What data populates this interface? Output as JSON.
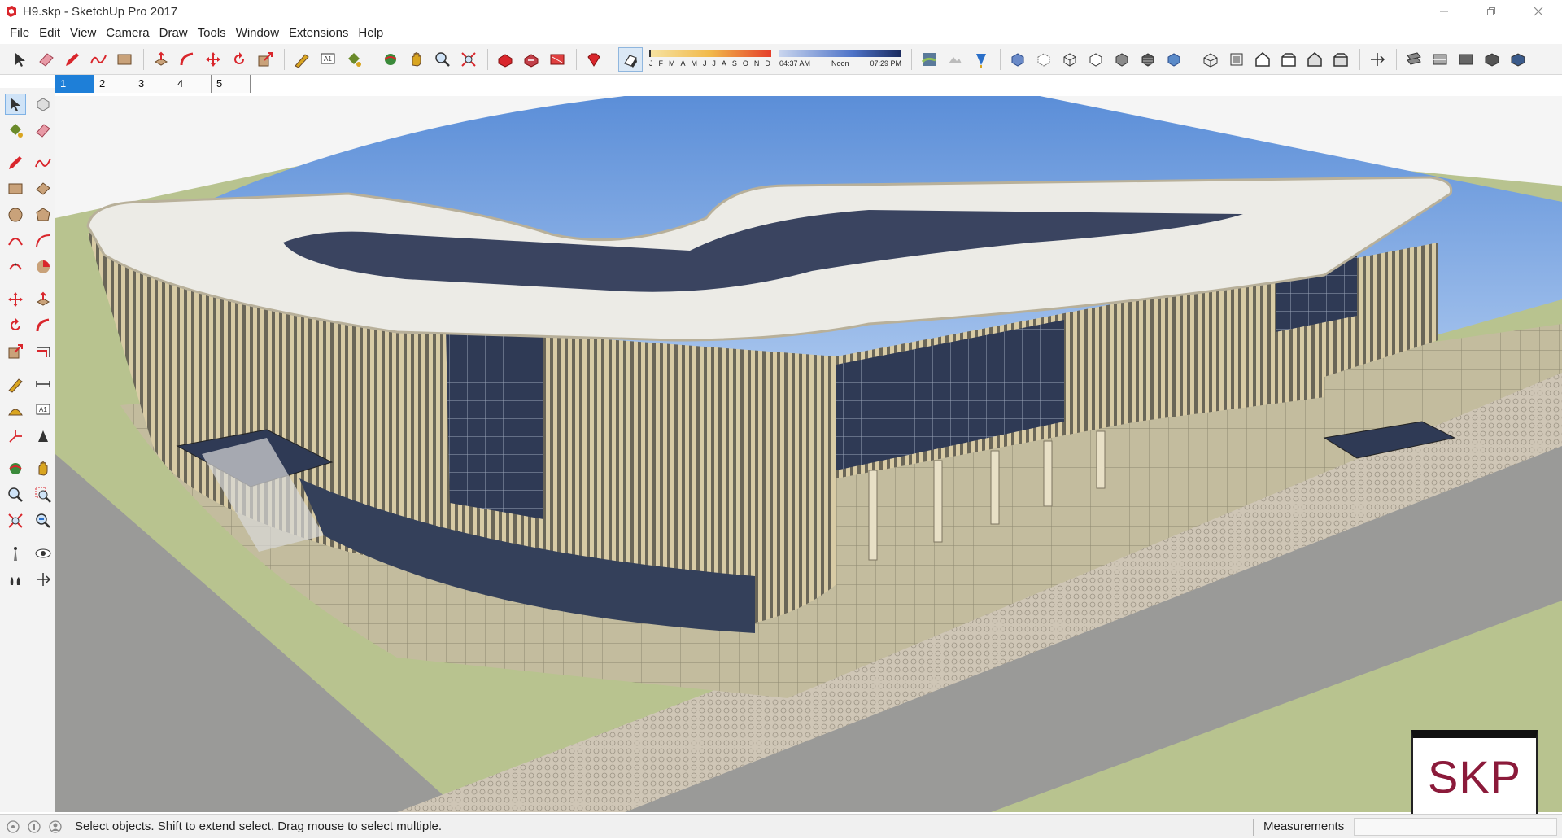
{
  "window": {
    "title": "H9.skp - SketchUp Pro 2017",
    "controls": [
      "minimize",
      "maximize",
      "close"
    ]
  },
  "menubar": {
    "items": [
      "File",
      "Edit",
      "View",
      "Camera",
      "Draw",
      "Tools",
      "Window",
      "Extensions",
      "Help"
    ]
  },
  "toolbar": {
    "groups": [
      [
        "select-icon",
        "eraser-icon",
        "pencil-icon",
        "freehand-icon",
        "rectangle-icon"
      ],
      [
        "push-pull-icon",
        "follow-me-icon",
        "move-icon",
        "rotate-icon",
        "scale-icon"
      ],
      [
        "tape-measure-icon",
        "text-icon",
        "paint-bucket-icon"
      ],
      [
        "orbit-icon",
        "pan-icon",
        "zoom-icon",
        "zoom-extents-icon"
      ],
      [
        "3d-warehouse-icon",
        "extension-warehouse-icon",
        "layout-icon"
      ],
      [
        "ruby-icon"
      ]
    ],
    "shadows": {
      "toggle_icon": "shadows-toggle-icon",
      "months": [
        "J",
        "F",
        "M",
        "A",
        "M",
        "J",
        "J",
        "A",
        "S",
        "O",
        "N",
        "D"
      ],
      "time_start": "04:37 AM",
      "time_mid": "Noon",
      "time_end": "07:29 PM"
    },
    "groups_after": [
      [
        "add-location-icon",
        "toggle-terrain-icon",
        "photo-textures-icon"
      ],
      [
        "xray-icon",
        "back-edges-icon",
        "wireframe-icon",
        "hidden-line-icon",
        "shaded-icon",
        "shaded-textures-icon",
        "monochrome-icon"
      ],
      [
        "iso-view-icon",
        "top-view-icon",
        "front-view-icon",
        "right-view-icon",
        "back-view-icon",
        "left-view-icon"
      ],
      [
        "section-plane-icon"
      ],
      [
        "display-section-planes-icon",
        "display-section-cuts-icon",
        "display-section-fill-icon",
        "components-icon",
        "styles-icon"
      ]
    ]
  },
  "scenes": {
    "tabs": [
      "1",
      "2",
      "3",
      "4",
      "5"
    ],
    "active": "1"
  },
  "lefttools": {
    "rows": [
      [
        "select-icon",
        "make-component-icon"
      ],
      [
        "paint-bucket-icon",
        "eraser-icon"
      ],
      [
        "gap"
      ],
      [
        "line-icon",
        "freehand-icon"
      ],
      [
        "rectangle-icon",
        "rotated-rectangle-icon"
      ],
      [
        "circle-icon",
        "polygon-icon"
      ],
      [
        "arc-icon",
        "two-point-arc-icon"
      ],
      [
        "three-point-arc-icon",
        "pie-icon"
      ],
      [
        "gap"
      ],
      [
        "move-icon",
        "push-pull-icon"
      ],
      [
        "rotate-icon",
        "follow-me-icon"
      ],
      [
        "scale-icon",
        "offset-icon"
      ],
      [
        "gap"
      ],
      [
        "tape-measure-icon",
        "dimensions-icon"
      ],
      [
        "protractor-icon",
        "text-icon"
      ],
      [
        "axes-icon",
        "3d-text-icon"
      ],
      [
        "gap"
      ],
      [
        "orbit-icon",
        "pan-icon"
      ],
      [
        "zoom-icon",
        "zoom-window-icon"
      ],
      [
        "zoom-extents-icon",
        "previous-view-icon"
      ],
      [
        "gap"
      ],
      [
        "position-camera-icon",
        "look-around-icon"
      ],
      [
        "walk-icon",
        "section-plane-icon"
      ]
    ]
  },
  "badge": {
    "text": "SKP"
  },
  "statusbar": {
    "icons": [
      "geo-location-icon",
      "credits-icon",
      "user-icon"
    ],
    "message": "Select objects. Shift to extend select. Drag mouse to select multiple.",
    "measurements_label": "Measurements",
    "measurements_value": ""
  },
  "colors": {
    "sky": "#7aa7e0",
    "ground": "#b8c38f",
    "road": "#9a9a98",
    "facade": "#cdbd96",
    "glass": "#3a4560",
    "roof": "#ecebe6",
    "selection": "#1e7fd8",
    "badge_text": "#8b1a3a"
  }
}
